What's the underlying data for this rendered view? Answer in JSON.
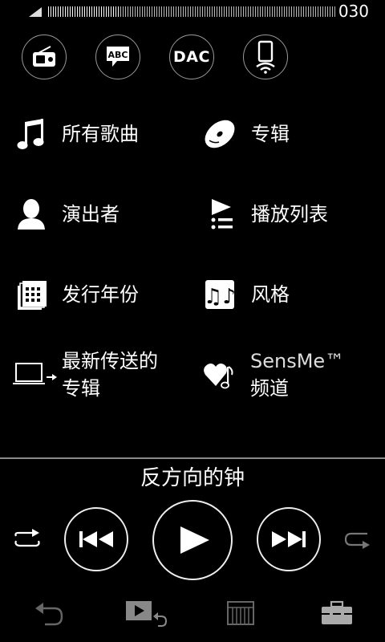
{
  "status": {
    "volume_level": 0.25,
    "volume_value": "030"
  },
  "top_buttons": [
    {
      "icon": "radio-icon"
    },
    {
      "icon": "abc-lyrics-icon"
    },
    {
      "icon": "dac-icon",
      "label": "DAC"
    },
    {
      "icon": "phone-wireless-icon"
    }
  ],
  "menu": {
    "all_songs": "所有歌曲",
    "albums": "专辑",
    "artists": "演出者",
    "playlists": "播放列表",
    "release_year": "发行年份",
    "genre": "风格",
    "recent_albums_line1": "最新传送的",
    "recent_albums_line2": "专辑",
    "sensme_line1": "SensMe™",
    "sensme_line2": "频道"
  },
  "player": {
    "track_title": "反方向的钟"
  },
  "colors": {
    "background": "#000000",
    "text": "#ffffff",
    "dim": "#8a8a8a"
  }
}
